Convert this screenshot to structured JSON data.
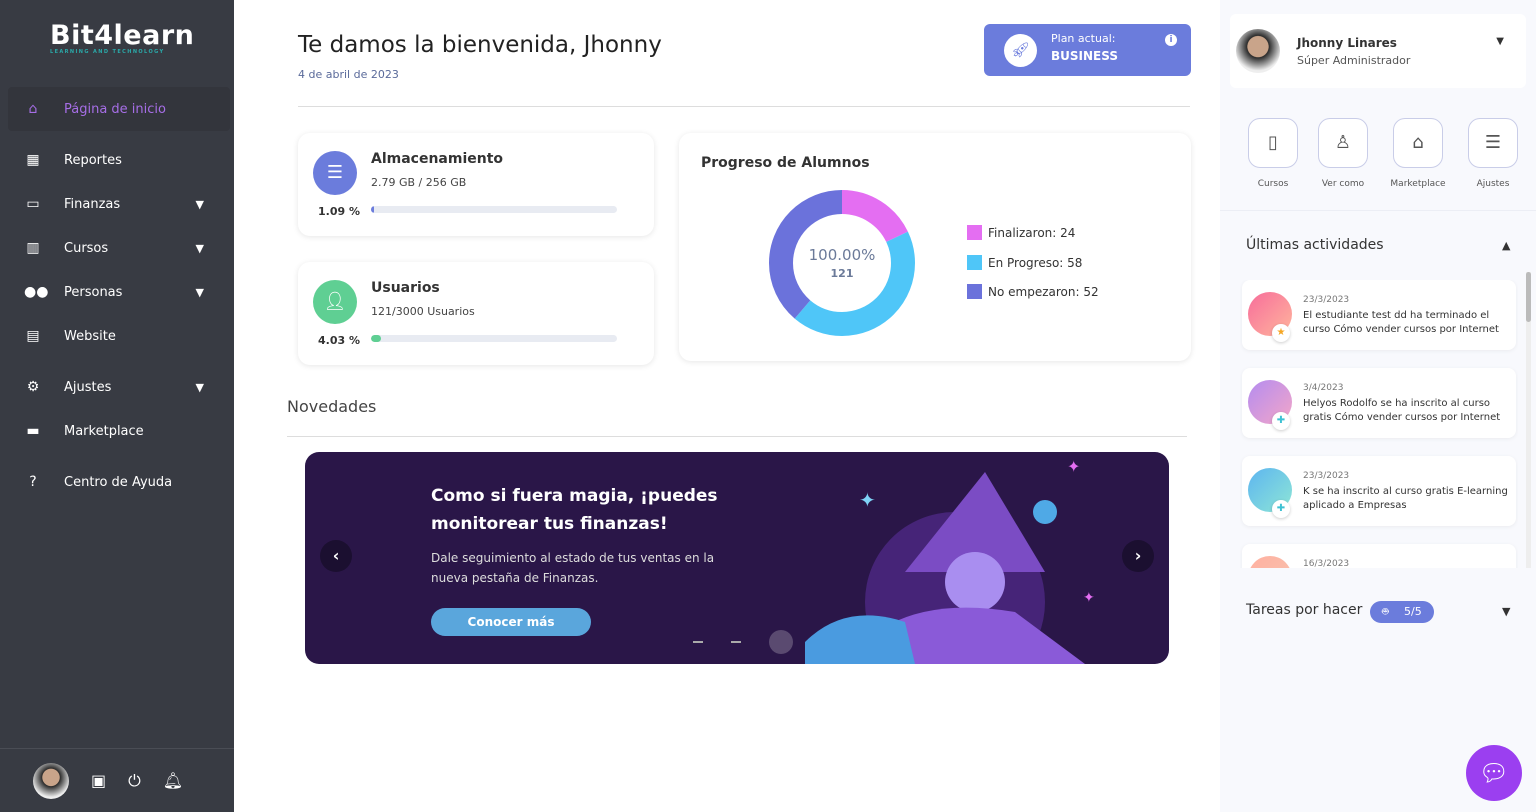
{
  "brand": {
    "name": "Bit4learn",
    "tagline": "LEARNING AND TECHNOLOGY"
  },
  "sidebar": {
    "items": [
      {
        "label": "Página de inicio",
        "icon": "home-icon",
        "active": true
      },
      {
        "label": "Reportes",
        "icon": "chart-icon"
      },
      {
        "label": "Finanzas",
        "icon": "money-icon",
        "expandable": true
      },
      {
        "label": "Cursos",
        "icon": "books-icon",
        "expandable": true
      },
      {
        "label": "Personas",
        "icon": "people-icon",
        "expandable": true
      },
      {
        "label": "Website",
        "icon": "table-icon"
      },
      {
        "label": "Ajustes",
        "icon": "gear-icon",
        "expandable": true
      },
      {
        "label": "Marketplace",
        "icon": "store-icon"
      },
      {
        "label": "Centro de Ayuda",
        "icon": "help-icon"
      }
    ]
  },
  "header": {
    "title": "Te damos la bienvenida, Jhonny",
    "date": "4 de abril de 2023",
    "plan_label": "Plan actual:",
    "plan_value": "BUSINESS"
  },
  "storage": {
    "title": "Almacenamiento",
    "detail": "2.79 GB / 256 GB",
    "percent_label": "1.09 %",
    "percent": 1.09,
    "color": "#6b7cdc"
  },
  "users": {
    "title": "Usuarios",
    "detail": "121/3000 Usuarios",
    "percent_label": "4.03 %",
    "percent": 4.03,
    "color": "#5fcf93"
  },
  "progress": {
    "title": "Progreso de Alumnos",
    "center_pct": "100.00%",
    "center_total": "121",
    "chart_data": {
      "type": "pie",
      "categories": [
        "Finalizaron",
        "En Progreso",
        "No empezaron"
      ],
      "values": [
        24,
        58,
        52
      ],
      "colors": [
        "#e46ef2",
        "#4fc6f8",
        "#6b72db"
      ]
    },
    "legend": [
      "Finalizaron: 24",
      "En Progreso: 58",
      "No empezaron: 52"
    ]
  },
  "news": {
    "title": "Novedades",
    "banner_title": "Como si fuera magia, ¡puedes monitorear tus finanzas!",
    "banner_text": "Dale seguimiento al estado de tus ventas en la nueva pestaña de Finanzas.",
    "banner_button": "Conocer más",
    "slides": 3,
    "active_slide": 3
  },
  "user": {
    "name": "Jhonny Linares",
    "role": "Súper Administrador"
  },
  "quick": [
    {
      "label": "Cursos",
      "icon": "book-icon"
    },
    {
      "label": "Ver como",
      "icon": "joystick-icon"
    },
    {
      "label": "Marketplace",
      "icon": "store-icon"
    },
    {
      "label": "Ajustes",
      "icon": "sliders-icon"
    }
  ],
  "activities": {
    "title": "Últimas actividades",
    "items": [
      {
        "date": "23/3/2023",
        "text": "El estudiante test dd ha terminado el curso Cómo vender cursos por Internet",
        "badge": "star-icon"
      },
      {
        "date": "3/4/2023",
        "text": "Helyos Rodolfo se ha inscrito al curso gratis Cómo vender cursos por Internet",
        "badge": "plus-icon"
      },
      {
        "date": "23/3/2023",
        "text": "K se ha inscrito al curso gratis E-learning aplicado a Empresas",
        "badge": "plus-icon"
      },
      {
        "date": "16/3/2023",
        "text": "",
        "badge": ""
      }
    ]
  },
  "tasks": {
    "title": "Tareas por hacer",
    "count": "5/5"
  }
}
